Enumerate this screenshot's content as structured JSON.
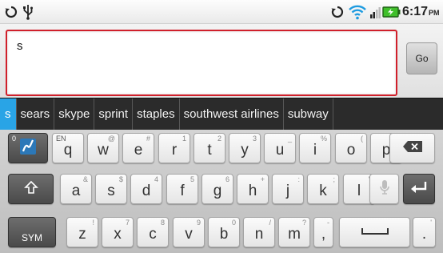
{
  "status_bar": {
    "time": "6:17",
    "ampm": "PM"
  },
  "input": {
    "value": "s"
  },
  "go_button": {
    "label": "Go"
  },
  "suggestions": [
    "s",
    "sears",
    "skype",
    "sprint",
    "staples",
    "southwest airlines",
    "subway"
  ],
  "keys": {
    "row1": [
      {
        "label": "q",
        "hint": "EN"
      },
      {
        "label": "w",
        "hint": "@"
      },
      {
        "label": "e",
        "hint": "#"
      },
      {
        "label": "r",
        "hint": "1"
      },
      {
        "label": "t",
        "hint": "2"
      },
      {
        "label": "y",
        "hint": "3"
      },
      {
        "label": "u",
        "hint": "_"
      },
      {
        "label": "i",
        "hint": "%"
      },
      {
        "label": "o",
        "hint": "("
      },
      {
        "label": "p",
        "hint": ")"
      }
    ],
    "row2": [
      {
        "label": "a",
        "hint": "&"
      },
      {
        "label": "s",
        "hint": "$"
      },
      {
        "label": "d",
        "hint": "4"
      },
      {
        "label": "f",
        "hint": "5"
      },
      {
        "label": "g",
        "hint": "6"
      },
      {
        "label": "h",
        "hint": "+"
      },
      {
        "label": "j",
        "hint": ":"
      },
      {
        "label": "k",
        "hint": ";"
      },
      {
        "label": "l",
        "hint": "\""
      }
    ],
    "row3": [
      {
        "label": "z",
        "hint": "!"
      },
      {
        "label": "x",
        "hint": "7"
      },
      {
        "label": "c",
        "hint": "8"
      },
      {
        "label": "v",
        "hint": "9"
      },
      {
        "label": "b",
        "hint": "0"
      },
      {
        "label": "n",
        "hint": "/"
      },
      {
        "label": "m",
        "hint": "?"
      }
    ],
    "comma": {
      "label": ",",
      "hint": "-"
    },
    "period": {
      "label": ".",
      "hint": "'"
    },
    "sym": {
      "label": "SYM"
    },
    "settings_hint": {
      "label": "0"
    }
  },
  "colors": {
    "accent_red": "#d0202b",
    "suggest_highlight": "#29a4e6",
    "battery_green": "#3fbf2a"
  }
}
